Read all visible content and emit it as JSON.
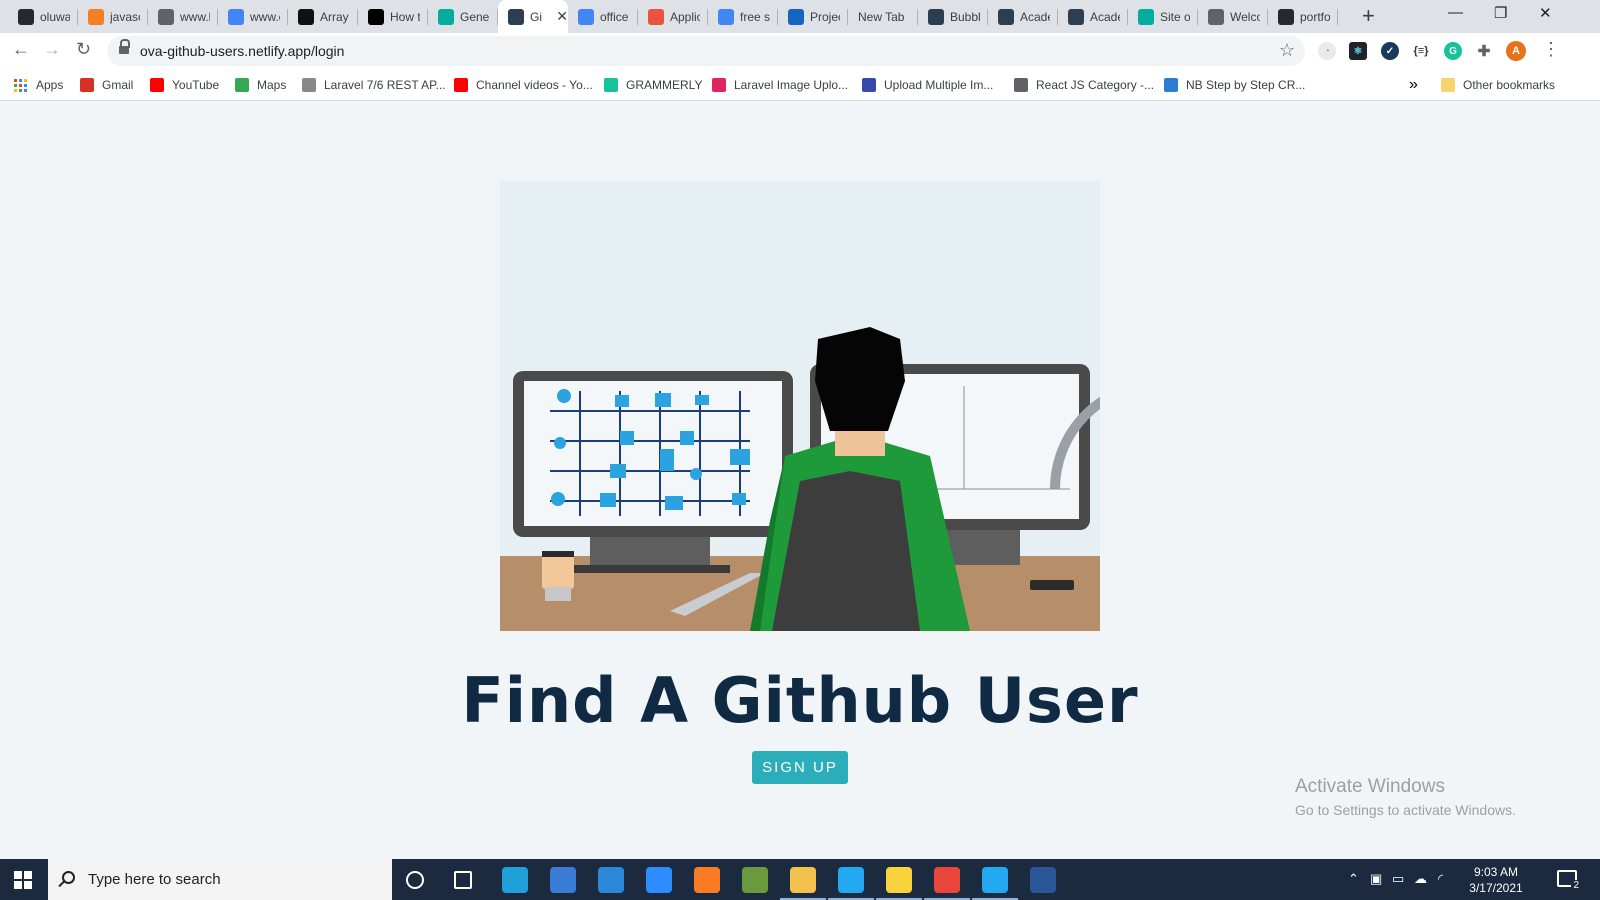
{
  "browser": {
    "tabs": [
      {
        "label": "oluwa",
        "icon": "github-icon",
        "color": "#24292e"
      },
      {
        "label": "javasc",
        "icon": "stackoverflow-icon",
        "color": "#f48024"
      },
      {
        "label": "www.l",
        "icon": "linkedin-icon",
        "color": "#5f6368"
      },
      {
        "label": "www.c",
        "icon": "google-icon",
        "color": "#4285f4"
      },
      {
        "label": "Array",
        "icon": "codepen-icon",
        "color": "#111111"
      },
      {
        "label": "How t",
        "icon": "dev-icon",
        "color": "#000000"
      },
      {
        "label": "Gener",
        "icon": "netlify-icon",
        "color": "#00ad9f"
      },
      {
        "label": "Gi",
        "icon": "react-icon",
        "color": "#2d3e50",
        "active": true
      },
      {
        "label": "office",
        "icon": "google-icon",
        "color": "#4285f4"
      },
      {
        "label": "Applic",
        "icon": "app-icon",
        "color": "#e8543d"
      },
      {
        "label": "free sv",
        "icon": "google-icon",
        "color": "#4285f4"
      },
      {
        "label": "Projec",
        "icon": "project-icon",
        "color": "#1565c0"
      },
      {
        "label": "New Tab",
        "icon": "",
        "color": ""
      },
      {
        "label": "Bubbl",
        "icon": "react-icon",
        "color": "#2d3e50"
      },
      {
        "label": "Acade",
        "icon": "react-icon",
        "color": "#2d3e50"
      },
      {
        "label": "Acade",
        "icon": "react-icon",
        "color": "#2d3e50"
      },
      {
        "label": "Site o",
        "icon": "netlify-icon",
        "color": "#00ad9f"
      },
      {
        "label": "Welco",
        "icon": "globe-icon",
        "color": "#5f6368"
      },
      {
        "label": "portfo",
        "icon": "github-icon",
        "color": "#24292e"
      }
    ],
    "new_tab_symbol": "+",
    "window_controls": {
      "minimize": "—",
      "restore": "❐",
      "close": "✕"
    },
    "url": "ova-github-users.netlify.app/login",
    "profile_initial": "A",
    "bookmarks": [
      {
        "label": "Apps",
        "icon": "apps-grid-icon",
        "color": "#4285f4"
      },
      {
        "label": "Gmail",
        "icon": "gmail-icon",
        "color": "#d93025"
      },
      {
        "label": "YouTube",
        "icon": "youtube-icon",
        "color": "#ff0000"
      },
      {
        "label": "Maps",
        "icon": "maps-icon",
        "color": "#34a853"
      },
      {
        "label": "Laravel 7/6 REST AP...",
        "icon": "laravel-icon",
        "color": "#888888"
      },
      {
        "label": "Channel videos - Yo...",
        "icon": "youtube-icon",
        "color": "#ff0000"
      },
      {
        "label": "GRAMMERLY",
        "icon": "grammarly-icon",
        "color": "#15c39a"
      },
      {
        "label": "Laravel Image Uplo...",
        "icon": "image-icon",
        "color": "#e0245e"
      },
      {
        "label": "Upload Multiple Im...",
        "icon": "cloud-icon",
        "color": "#3949ab"
      },
      {
        "label": "React JS Category -...",
        "icon": "globe-icon",
        "color": "#5f6368"
      },
      {
        "label": "NB Step by Step CR...",
        "icon": "word-w-icon",
        "color": "#2b7cd3"
      }
    ],
    "more_bookmarks_symbol": "»",
    "other_bookmarks": "Other bookmarks"
  },
  "page": {
    "heading": "Find A Github User",
    "signup_label": "SIGN UP",
    "hero_icon": "developer-at-desk-illustration"
  },
  "watermark": {
    "line1": "Activate Windows",
    "line2": "Go to Settings to activate Windows."
  },
  "taskbar": {
    "search_placeholder": "Type here to search",
    "apps": [
      {
        "icon": "cortana-icon",
        "color": ""
      },
      {
        "icon": "task-view-icon",
        "color": ""
      },
      {
        "icon": "edge-icon",
        "color": "#1fa0d8"
      },
      {
        "icon": "store-icon",
        "color": "#3a7bd5"
      },
      {
        "icon": "mail-icon",
        "color": "#2b88d8"
      },
      {
        "icon": "zoom-icon",
        "color": "#2d8cff"
      },
      {
        "icon": "xampp-icon",
        "color": "#fb7a24"
      },
      {
        "icon": "sql-icon",
        "color": "#6a9a3d"
      },
      {
        "icon": "file-explorer-icon",
        "color": "#f2c14e"
      },
      {
        "icon": "vscode-icon",
        "color": "#23a9f2"
      },
      {
        "icon": "sticky-notes-icon",
        "color": "#f7d33c"
      },
      {
        "icon": "chrome-icon",
        "color": "#e8453c"
      },
      {
        "icon": "vscode-icon",
        "color": "#23a9f2"
      },
      {
        "icon": "word-icon",
        "color": "#2b579a"
      }
    ],
    "time": "9:03 AM",
    "date": "3/17/2021",
    "notification_count": "2"
  }
}
